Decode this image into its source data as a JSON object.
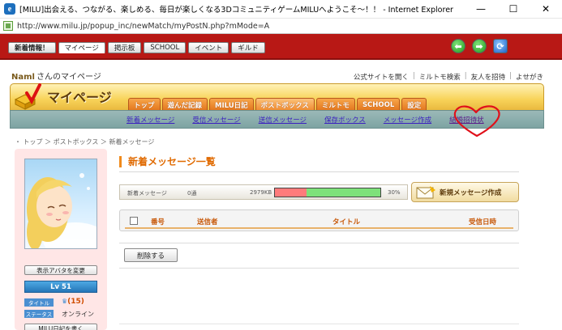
{
  "window": {
    "title": "[MILU]出会える、つながる、楽しめる、毎日が楽しくなる3DコミュニティゲームMILUへようこそ～！！ - Internet Explorer",
    "minimize": "—",
    "maximize": "☐",
    "close": "✕"
  },
  "address": {
    "url": "http://www.milu.jp/popup_inc/newMatch/myPostN.php?mMode=A"
  },
  "sitenav": {
    "tabs": [
      "新着情報！",
      "マイページ",
      "掲示板",
      "SCHOOL",
      "イベント",
      "ギルド"
    ],
    "back": "⬅",
    "forward": "➡",
    "reload": "⟳"
  },
  "header": {
    "username": "Naml",
    "username_suffix": "さんのマイページ",
    "links": [
      "公式サイトを開く",
      "ミルトモ検索",
      "友人を招待",
      "よせがき"
    ],
    "banner_title": "マイページ",
    "main_tabs": [
      "トップ",
      "遊んだ記録",
      "MILU日記",
      "ポストボックス",
      "ミルトモ",
      "SCHOOL",
      "設定"
    ]
  },
  "subnav": [
    "新着メッセージ",
    "受信メッセージ",
    "送信メッセージ",
    "保存ボックス",
    "メッセージ作成",
    "結婚招待状"
  ],
  "breadcrumb": "・ トップ ＞ ポストボックス ＞ 新着メッセージ",
  "profile": {
    "avatar_button": "表示アバタを変更",
    "level": "Lv 51",
    "title_label": "タイトル",
    "title_value_num": "(15)",
    "status_label": "ステータス",
    "status_value": "オンライン",
    "diary_button": "MILU日記を書く"
  },
  "main": {
    "section_title": "新着メッセージ一覧",
    "status": {
      "label": "新着メッセージ",
      "count": "0通",
      "capacity": "2979KB",
      "percent_text": "30%",
      "usage_fraction": 0.3
    },
    "new_message_button": "新規メッセージ作成",
    "table_headers": {
      "number": "番号",
      "sender": "送信者",
      "title": "タイトル",
      "date": "受信日時"
    },
    "delete_button": "削除する"
  },
  "colors": {
    "site_red": "#b81815",
    "accent_orange": "#e06a00",
    "subnav_teal": "#8aaead",
    "heart_red": "#e0101a"
  }
}
